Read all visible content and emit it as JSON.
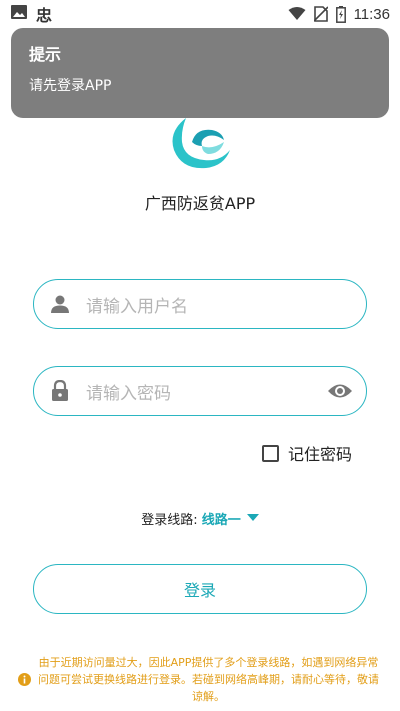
{
  "statusbar": {
    "time": "11:36",
    "app_glyph": "忠"
  },
  "toast": {
    "title": "提示",
    "message": "请先登录APP"
  },
  "app": {
    "name": "广西防返贫APP"
  },
  "form": {
    "username_placeholder": "请输入用户名",
    "password_placeholder": "请输入密码",
    "remember_label": "记住密码",
    "route_label": "登录线路:",
    "route_value": "线路一",
    "login_label": "登录"
  },
  "notice": {
    "text": "由于近期访问量过大，因此APP提供了多个登录线路，如遇到网络异常问题可尝试更换线路进行登录。若碰到网络高峰期，请耐心等待，敬请谅解。"
  },
  "colors": {
    "accent": "#2bb6c2",
    "notice": "#e29e18",
    "toast": "#7e7e7e"
  }
}
